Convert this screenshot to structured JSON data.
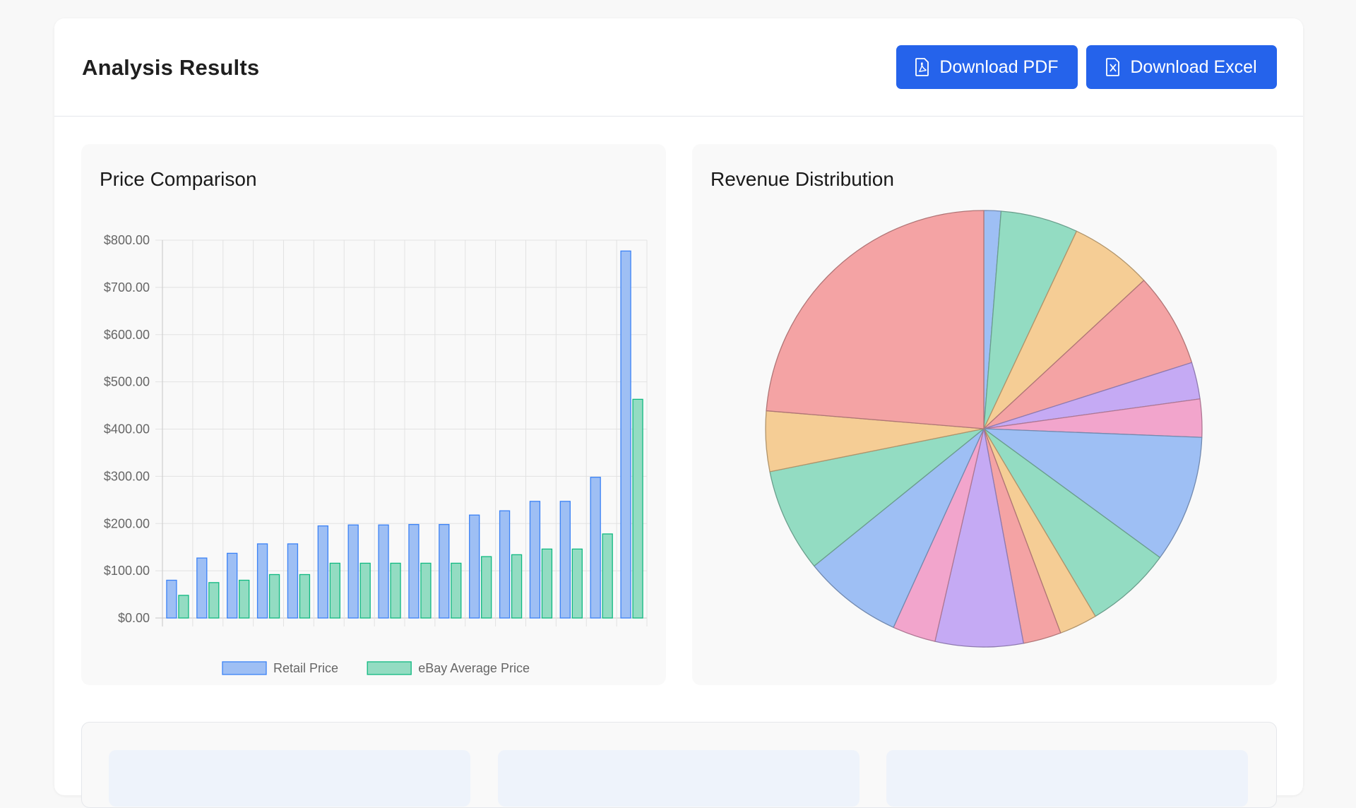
{
  "header": {
    "title": "Analysis Results",
    "download_pdf_label": "Download PDF",
    "download_excel_label": "Download Excel"
  },
  "colors": {
    "accent": "#2563eb",
    "blue_fill": "#9ebff4",
    "blue_stroke": "#3b82f6",
    "green_fill": "#93dcc2",
    "green_stroke": "#10b981"
  },
  "price_chart": {
    "title": "Price Comparison"
  },
  "revenue_chart": {
    "title": "Revenue Distribution"
  },
  "chart_data": [
    {
      "type": "bar",
      "title": "Price Comparison",
      "categories": [
        "",
        "",
        "",
        "",
        "",
        "",
        "",
        "",
        "",
        "",
        "",
        "",
        "",
        "",
        "",
        ""
      ],
      "series": [
        {
          "name": "Retail Price",
          "values": [
            80,
            127,
            137,
            157,
            157,
            195,
            197,
            197,
            198,
            198,
            218,
            227,
            247,
            247,
            298,
            777
          ]
        },
        {
          "name": "eBay Average Price",
          "values": [
            48,
            75,
            80,
            92,
            92,
            116,
            116,
            116,
            116,
            116,
            130,
            134,
            146,
            146,
            178,
            463
          ]
        }
      ],
      "ylim": [
        0,
        800
      ],
      "yticks": [
        "$0.00",
        "$100.00",
        "$200.00",
        "$300.00",
        "$400.00",
        "$500.00",
        "$600.00",
        "$700.00",
        "$800.00"
      ],
      "grid": true,
      "legend": "bottom"
    },
    {
      "type": "pie",
      "title": "Revenue Distribution",
      "slices": [
        {
          "value": 1.3,
          "color": "#9ebff4"
        },
        {
          "value": 5.9,
          "color": "#93dcc2"
        },
        {
          "value": 6.3,
          "color": "#f5cd95"
        },
        {
          "value": 7.2,
          "color": "#f4a3a4"
        },
        {
          "value": 2.8,
          "color": "#c5aaf4"
        },
        {
          "value": 2.9,
          "color": "#f2a5cc"
        },
        {
          "value": 9.7,
          "color": "#9ebff4"
        },
        {
          "value": 6.6,
          "color": "#93dcc2"
        },
        {
          "value": 2.9,
          "color": "#f5cd95"
        },
        {
          "value": 2.9,
          "color": "#f4a3a4"
        },
        {
          "value": 6.7,
          "color": "#c5aaf4"
        },
        {
          "value": 3.3,
          "color": "#f2a5cc"
        },
        {
          "value": 7.6,
          "color": "#9ebff4"
        },
        {
          "value": 7.9,
          "color": "#93dcc2"
        },
        {
          "value": 4.6,
          "color": "#f5cd95"
        },
        {
          "value": 24.4,
          "color": "#f4a3a4"
        }
      ],
      "legend": "none"
    }
  ]
}
